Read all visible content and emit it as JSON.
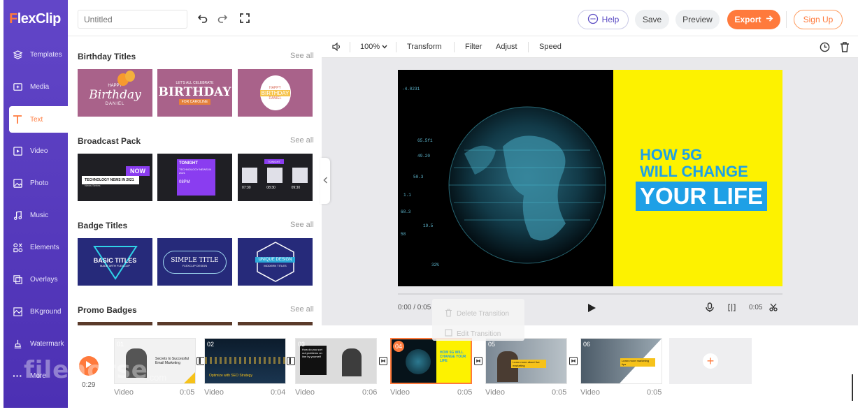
{
  "app": {
    "logo_prefix": "F",
    "logo_rest": "lexClip",
    "project_title_placeholder": "Untitled"
  },
  "topbar": {
    "help": "Help",
    "save": "Save",
    "preview": "Preview",
    "export": "Export",
    "signup": "Sign Up"
  },
  "sidebar": {
    "items": [
      {
        "label": "Templates",
        "icon": "templates-icon"
      },
      {
        "label": "Media",
        "icon": "media-icon"
      },
      {
        "label": "Text",
        "icon": "text-icon",
        "active": true
      },
      {
        "label": "Video",
        "icon": "video-icon"
      },
      {
        "label": "Photo",
        "icon": "photo-icon"
      },
      {
        "label": "Music",
        "icon": "music-icon"
      },
      {
        "label": "Elements",
        "icon": "elements-icon"
      },
      {
        "label": "Overlays",
        "icon": "overlays-icon"
      },
      {
        "label": "BKground",
        "icon": "background-icon"
      },
      {
        "label": "Watermark",
        "icon": "watermark-icon"
      },
      {
        "label": "More",
        "icon": "more-icon"
      }
    ]
  },
  "panel": {
    "see_all": "See all",
    "sections": [
      {
        "title": "Birthday Titles",
        "thumbs": [
          {
            "line1": "HAPPY",
            "line2": "Birthday",
            "line3": "DANIEL"
          },
          {
            "line1": "LET'S ALL CELEBRATE",
            "line2": "BIRTHDAY",
            "line3": "FOR CAROLINE"
          },
          {
            "line1": "HAPPY",
            "line2": "BIRTHDAY",
            "line3": "DANIEL"
          }
        ]
      },
      {
        "title": "Broadcast Pack",
        "thumbs": [
          {
            "line1": "NOW",
            "line2": "TECHNOLOGY NEWS IN 2021",
            "line3": "News Series"
          },
          {
            "line1": "TONIGHT",
            "line2": "TECHNOLOGY NEWS IN 2021",
            "line3": "08PM"
          },
          {
            "line1": "TONIGHT",
            "line2": "07:30  08:30  09:30",
            "line3": ""
          }
        ]
      },
      {
        "title": "Badge Titles",
        "thumbs": [
          {
            "line1": "BASIC TITLES",
            "line2": "MADE WITH FLEXCLIP",
            "line3": ""
          },
          {
            "line1": "SIMPLE TITLE",
            "line2": "FLEXCLIP DESIGN",
            "line3": ""
          },
          {
            "line1": "UNIQUE DESIGN",
            "line2": "MODERN TITLES",
            "line3": ""
          }
        ]
      },
      {
        "title": "Promo Badges",
        "thumbs": []
      }
    ]
  },
  "stage_toolbar": {
    "zoom": "100%",
    "transform": "Transform",
    "filter": "Filter",
    "adjust": "Adjust",
    "speed": "Speed"
  },
  "preview": {
    "headline1": "HOW 5G",
    "headline2": "WILL CHANGE",
    "headline3": "YOUR LIFE",
    "time": "0:00 / 0:05",
    "clip_duration": "0:05",
    "overlay_numbers": [
      "-4.0231",
      "65.5f1",
      "49.20",
      "50.3",
      "1.1",
      "19.5",
      "68.3",
      "58",
      "32%"
    ]
  },
  "context_menu": {
    "delete": "Delete Transition",
    "edit": "Edit Transition"
  },
  "timeline": {
    "current_time": "0:29",
    "clips": [
      {
        "num": "01",
        "type": "Video",
        "duration": "0:05",
        "caption": "Secrets to Successful Email Marketing"
      },
      {
        "num": "02",
        "type": "Video",
        "duration": "0:04",
        "caption": "Optimize with SEO Strategy"
      },
      {
        "num": "03",
        "type": "Video",
        "duration": "0:06",
        "caption": "How do you sort out problems on line by yourself"
      },
      {
        "num": "04",
        "type": "Video",
        "duration": "0:05",
        "caption": "HOW 5G WILL CHANGE YOUR LIFE"
      },
      {
        "num": "05",
        "type": "Video",
        "duration": "0:05",
        "caption": "Learn more about live marketing"
      },
      {
        "num": "06",
        "type": "Video",
        "duration": "0:05",
        "caption": "Learn more marketing tips"
      }
    ]
  },
  "watermark": {
    "text": "filehorse",
    "domain": ".com"
  },
  "colors": {
    "accent": "#ff7a3c",
    "sidebar": "#5a3dc0",
    "preview_yellow": "#fdf200",
    "headline_blue": "#1ea0e6"
  }
}
